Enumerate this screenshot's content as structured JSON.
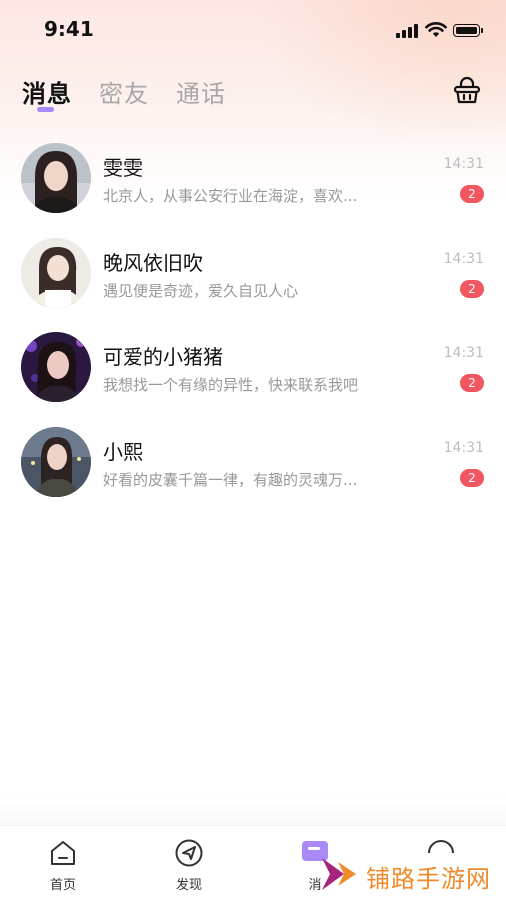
{
  "status_bar": {
    "time": "9:41"
  },
  "header": {
    "tabs": [
      {
        "label": "消息",
        "active": true
      },
      {
        "label": "密友",
        "active": false
      },
      {
        "label": "通话",
        "active": false
      }
    ],
    "right_icon": "basket-icon"
  },
  "conversations": [
    {
      "name": "雯雯",
      "preview": "北京人，从事公安行业在海淀，喜欢...",
      "time": "14:31",
      "unread": "2"
    },
    {
      "name": "晚风依旧吹",
      "preview": "遇见便是奇迹，爱久自见人心",
      "time": "14:31",
      "unread": "2"
    },
    {
      "name": "可爱的小猪猪",
      "preview": "我想找一个有缘的异性，快来联系我吧",
      "time": "14:31",
      "unread": "2"
    },
    {
      "name": "小熙",
      "preview": "好看的皮囊千篇一律，有趣的灵魂万...",
      "time": "14:31",
      "unread": "2"
    }
  ],
  "tabbar": {
    "items": [
      {
        "label": "首页",
        "icon": "home-icon"
      },
      {
        "label": "发现",
        "icon": "compass-icon"
      },
      {
        "label": "消",
        "icon": "message-icon",
        "active": true
      },
      {
        "label": "",
        "icon": "profile-icon"
      }
    ]
  },
  "watermark": {
    "text": "铺路手游网"
  },
  "colors": {
    "accent": "#a98af7",
    "badge": "#f25660",
    "watermark": "#f08a2a"
  }
}
